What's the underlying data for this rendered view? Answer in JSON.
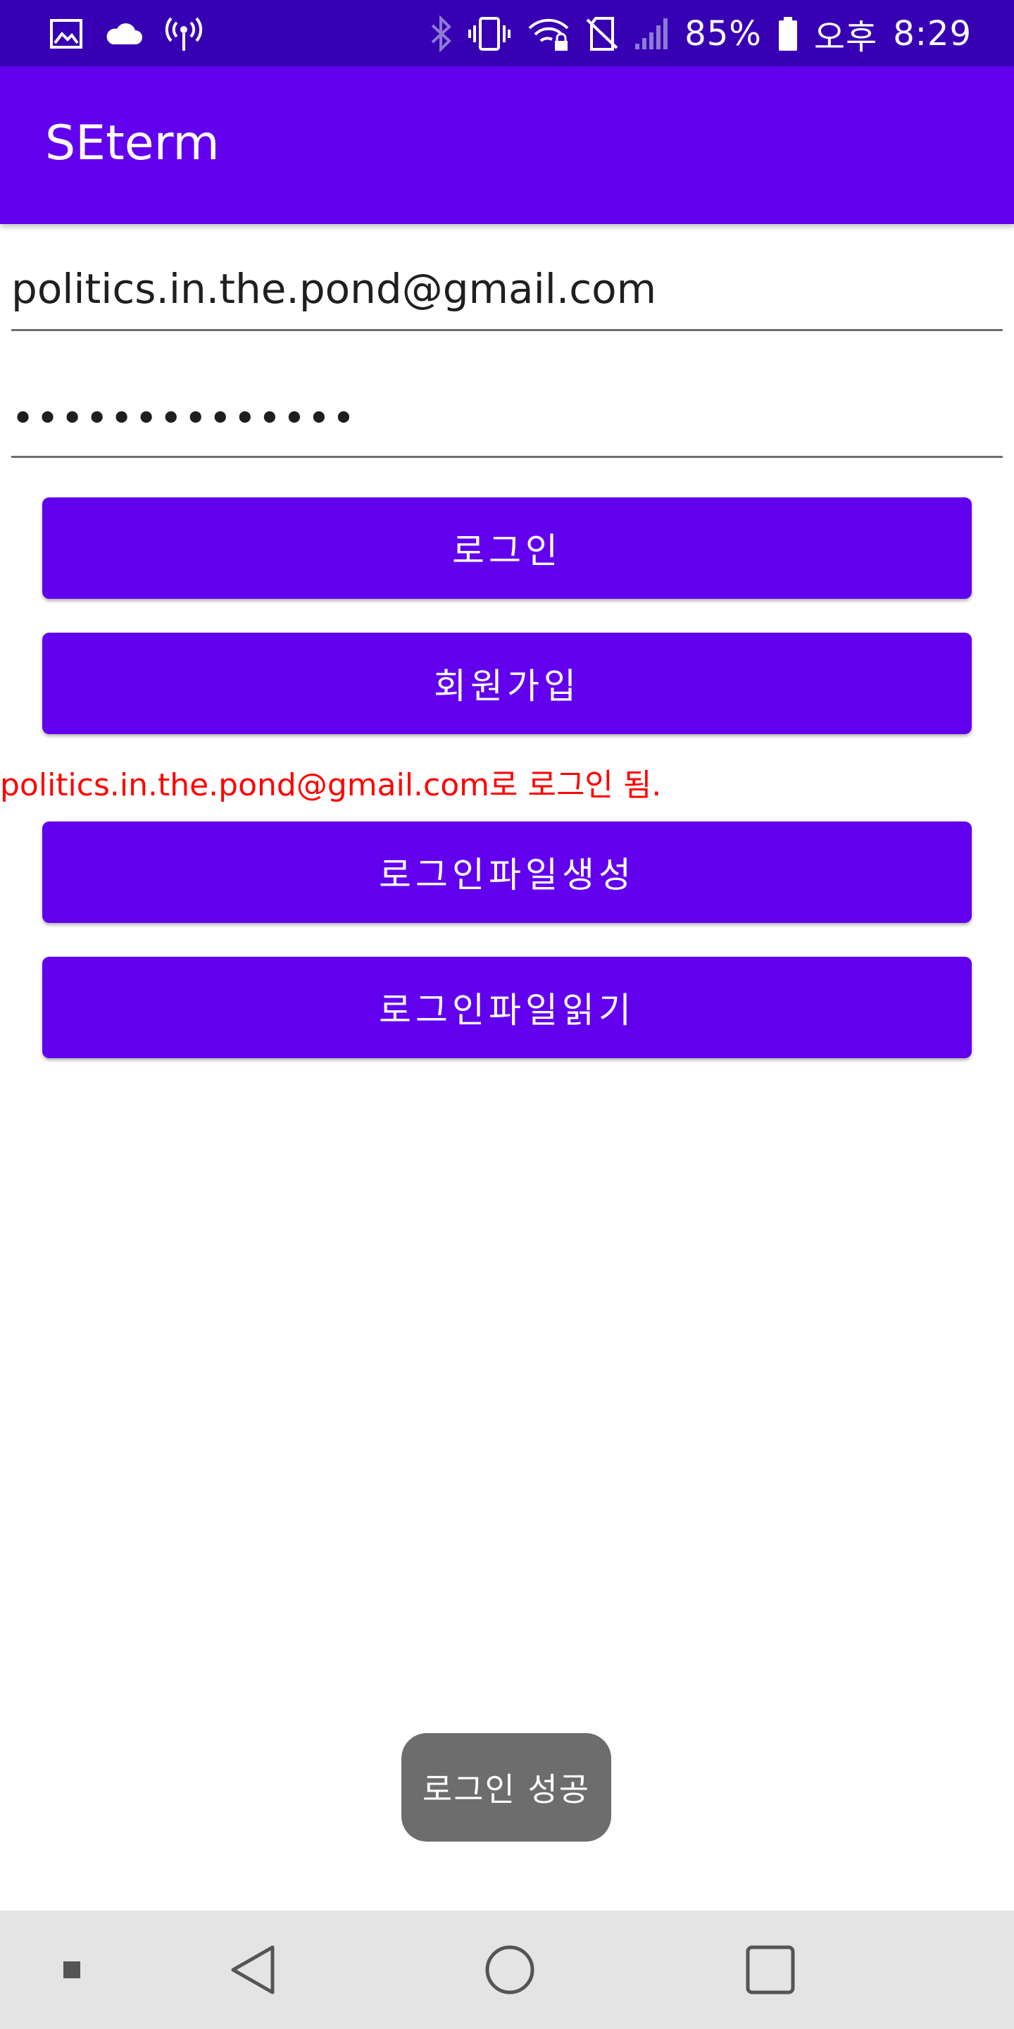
{
  "status_bar": {
    "battery_percent": "85%",
    "ampm": "오후",
    "time": "8:29",
    "left_icons": [
      "image-icon",
      "cloud-icon",
      "wireless-broadcast-icon"
    ],
    "right_icons": [
      "bluetooth-icon",
      "vibrate-icon",
      "wifi-lock-icon",
      "no-sim-icon",
      "signal-icon",
      "battery-icon"
    ]
  },
  "app_bar": {
    "title": "SEterm"
  },
  "form": {
    "email_value": "politics.in.the.pond@gmail.com",
    "password_value": "••••••••••••••"
  },
  "buttons": {
    "login": "로그인",
    "signup": "회원가입",
    "create_login_file": "로그인파일생성",
    "read_login_file": "로그인파일읽기"
  },
  "status_message": "politics.in.the.pond@gmail.com로 로그인 됨.",
  "toast": {
    "message": "로그인 성공"
  },
  "nav_bar": {
    "items": [
      "dot-icon",
      "back-icon",
      "home-icon",
      "recents-icon"
    ]
  },
  "colors": {
    "status_bar": "#3700b3",
    "primary": "#6200ee",
    "message": "#ff0000",
    "toast": "#6d6d6d",
    "nav_bar": "#e4e4e4"
  }
}
